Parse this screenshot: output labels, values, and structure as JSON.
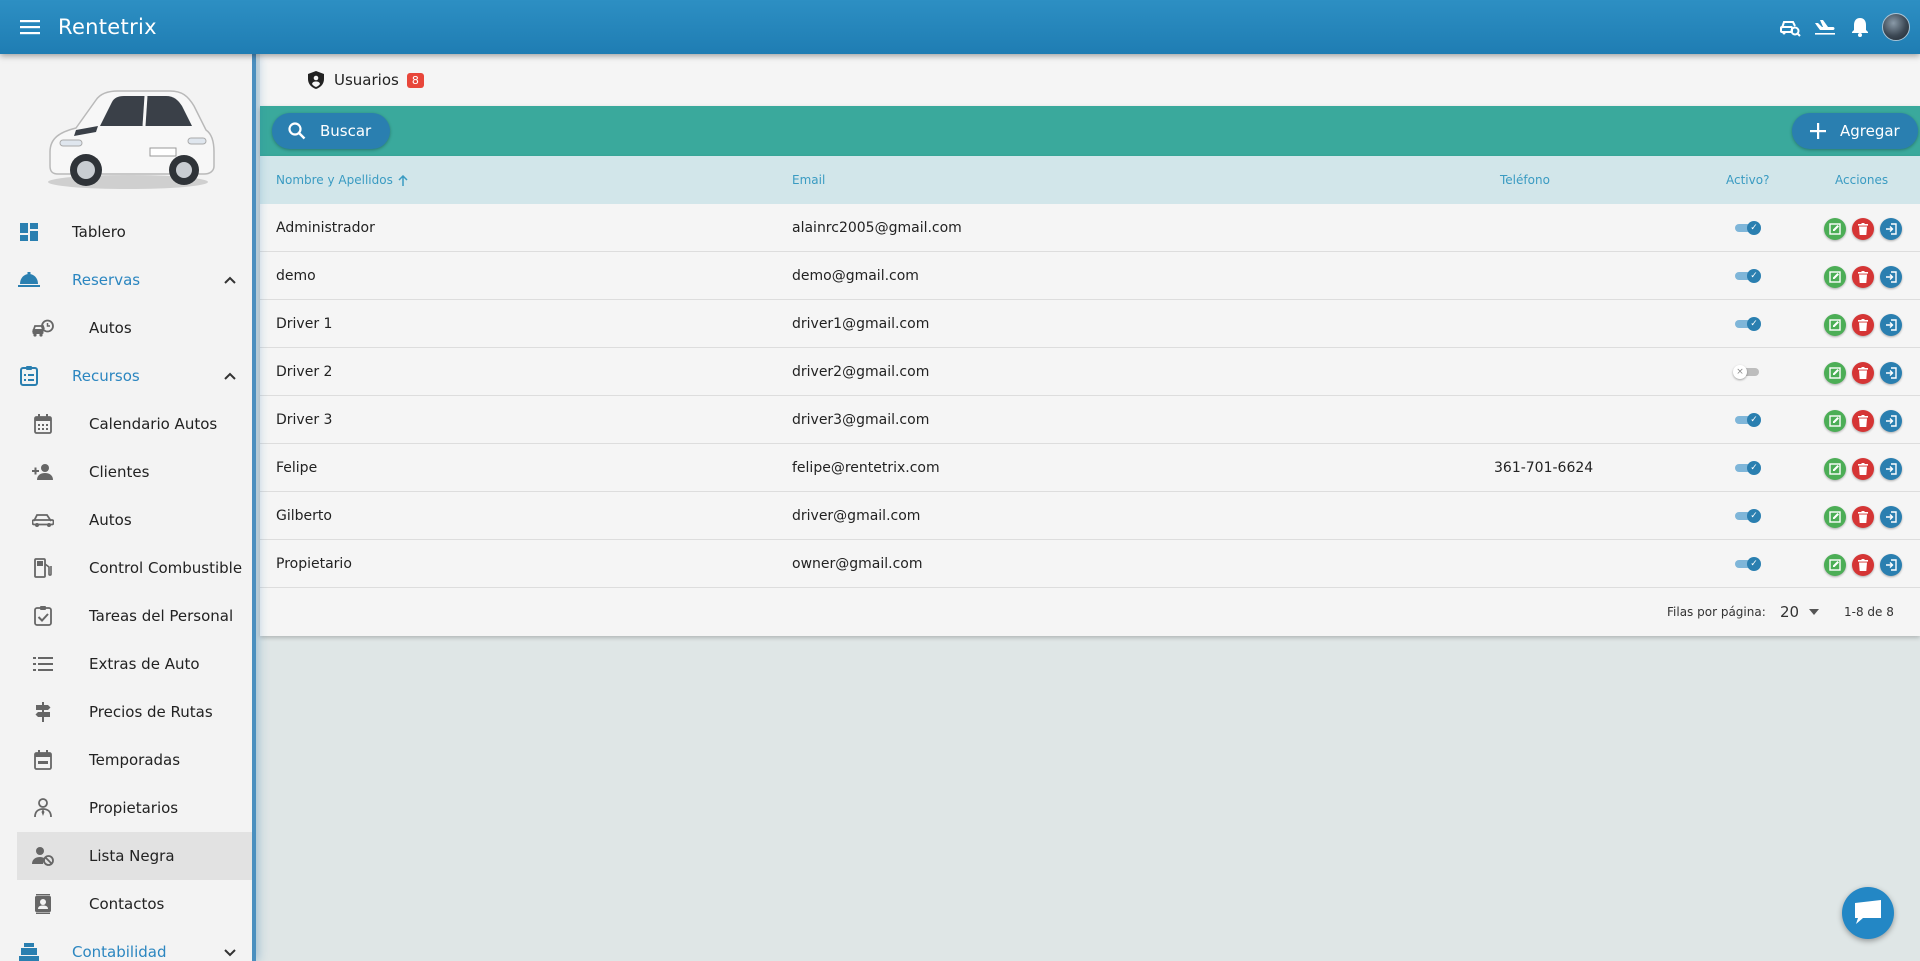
{
  "app": {
    "title": "Rentetrix"
  },
  "topbar": {
    "icons": [
      "car-search-icon",
      "airplane-landing-icon",
      "bell-icon",
      "user-avatar"
    ]
  },
  "sidebar": {
    "items": [
      {
        "label": "Tablero",
        "icon": "dashboard-icon",
        "type": "top"
      },
      {
        "label": "Reservas",
        "icon": "service-bell-icon",
        "type": "group",
        "expanded": true
      },
      {
        "label": "Autos",
        "icon": "car-clock-icon",
        "type": "sub"
      },
      {
        "label": "Recursos",
        "icon": "clipboard-list-icon",
        "type": "group",
        "expanded": true
      },
      {
        "label": "Calendario Autos",
        "icon": "calendar-icon",
        "type": "sub"
      },
      {
        "label": "Clientes",
        "icon": "person-add-icon",
        "type": "sub"
      },
      {
        "label": "Autos",
        "icon": "car-icon",
        "type": "sub"
      },
      {
        "label": "Control Combustible",
        "icon": "fuel-pump-icon",
        "type": "sub"
      },
      {
        "label": "Tareas del Personal",
        "icon": "clipboard-check-icon",
        "type": "sub"
      },
      {
        "label": "Extras de Auto",
        "icon": "list-icon",
        "type": "sub"
      },
      {
        "label": "Precios de Rutas",
        "icon": "signpost-icon",
        "type": "sub"
      },
      {
        "label": "Temporadas",
        "icon": "calendar-range-icon",
        "type": "sub"
      },
      {
        "label": "Propietarios",
        "icon": "account-tie-icon",
        "type": "sub"
      },
      {
        "label": "Lista Negra",
        "icon": "account-cancel-icon",
        "type": "sub",
        "active": true
      },
      {
        "label": "Contactos",
        "icon": "contacts-icon",
        "type": "sub"
      },
      {
        "label": "Contabilidad",
        "icon": "cash-register-icon",
        "type": "group",
        "expanded": false
      }
    ]
  },
  "page": {
    "title": "Usuarios",
    "count": "8"
  },
  "toolbar": {
    "search_label": "Buscar",
    "add_label": "Agregar"
  },
  "table": {
    "headers": {
      "name": "Nombre y Apellidos",
      "email": "Email",
      "phone": "Teléfono",
      "active": "Activo?",
      "actions": "Acciones"
    },
    "rows": [
      {
        "name": "Administrador",
        "email": "alainrc2005@gmail.com",
        "phone": "",
        "active": true
      },
      {
        "name": "demo",
        "email": "demo@gmail.com",
        "phone": "",
        "active": true
      },
      {
        "name": "Driver 1",
        "email": "driver1@gmail.com",
        "phone": "",
        "active": true
      },
      {
        "name": "Driver 2",
        "email": "driver2@gmail.com",
        "phone": "",
        "active": false
      },
      {
        "name": "Driver 3",
        "email": "driver3@gmail.com",
        "phone": "",
        "active": true
      },
      {
        "name": "Felipe",
        "email": "felipe@rentetrix.com",
        "phone": "361-701-6624",
        "active": true
      },
      {
        "name": "Gilberto",
        "email": "driver@gmail.com",
        "phone": "",
        "active": true
      },
      {
        "name": "Propietario",
        "email": "owner@gmail.com",
        "phone": "",
        "active": true
      }
    ]
  },
  "pagination": {
    "rows_per_page_label": "Filas por página:",
    "rows_per_page": "20",
    "range": "1-8 de 8"
  },
  "colors": {
    "topbar": "#2387c5",
    "toolbar": "#3aa99c",
    "header_row": "#d2e6ea",
    "accent": "#2a7fb0",
    "edit": "#4cae56",
    "delete": "#d53535",
    "badge": "#e8463a"
  }
}
